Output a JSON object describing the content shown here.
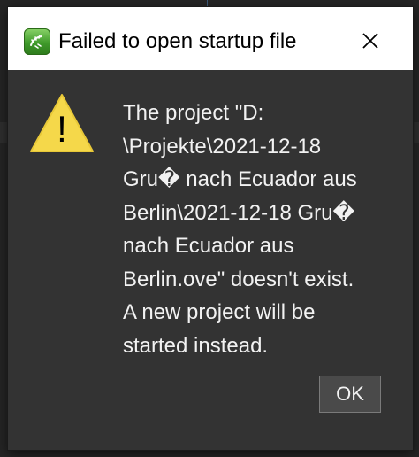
{
  "dialog": {
    "title": "Failed to open startup file",
    "app_icon": "app-logo-icon",
    "close_icon": "close-icon",
    "warning_icon": "warning-icon",
    "warning_symbol": "!",
    "message": "The project \"D:\n\\Projekte\\2021-12-18\nGru� nach Ecuador aus\nBerlin\\2021-12-18 Gru�\nnach Ecuador aus\nBerlin.ove\" doesn't exist.\nA new project will be\nstarted instead.",
    "ok_label": "OK"
  },
  "colors": {
    "titlebar": "#ffffff",
    "dialog_body": "#333333",
    "text": "#f2f2f2",
    "warning_fill": "#f5d84a",
    "button_bg": "#4a4a4a"
  }
}
